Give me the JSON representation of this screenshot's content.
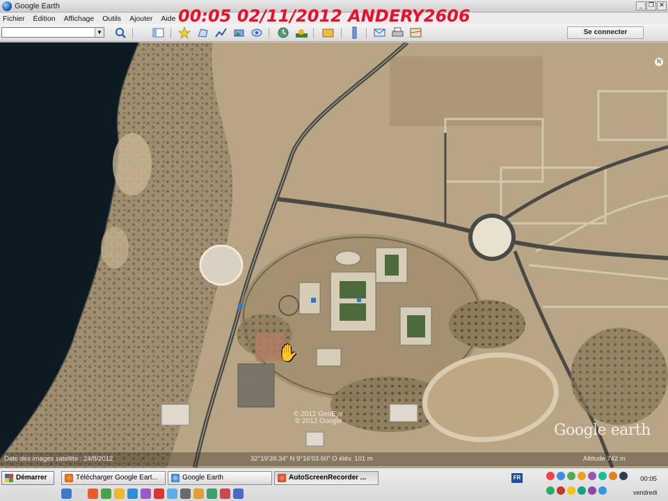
{
  "window": {
    "title": "Google Earth",
    "min": "_",
    "restore": "❐",
    "close": "✕"
  },
  "overlay_stamp": "00:05  02/11/2012  ANDERY2606",
  "menu": [
    "Fichier",
    "Édition",
    "Affichage",
    "Outils",
    "Ajouter",
    "Aide"
  ],
  "toolbar": {
    "search_value": "",
    "dropdown_glyph": "▼",
    "connect_label": "Se connecter",
    "icons": [
      "search-icon",
      "sidebar-toggle-icon",
      "placemark-icon",
      "polygon-icon",
      "path-icon",
      "image-overlay-icon",
      "tour-icon",
      "historical-imagery-icon",
      "sunlight-icon",
      "planets-icon",
      "ruler-icon",
      "email-icon",
      "print-icon",
      "view-in-maps-icon"
    ]
  },
  "map": {
    "watermark": "Google earth",
    "copyright_line1": "© 2012 GeoEye",
    "copyright_line2": "© 2012 Google",
    "compass": "N"
  },
  "status": {
    "imagery_date": "Date des images satellite : 24/8/2012",
    "coords": "32°19'39.34\" N   9°16'03.60\" O  élév.  101 m",
    "altitude": "Altitude    742 m"
  },
  "taskbar": {
    "start_label": "Démarrer",
    "tasks": [
      {
        "label": "Télécharger Google Eart...",
        "active": false
      },
      {
        "label": "Google Earth",
        "active": false
      },
      {
        "label": "AutoScreenRecorder ...",
        "active": true
      }
    ],
    "language": "FR",
    "time": "00:05",
    "day": "vendredi"
  },
  "colors": {
    "stamp": "#e8102a",
    "sea": "#0d1a22",
    "terrain": "#b39f80"
  }
}
